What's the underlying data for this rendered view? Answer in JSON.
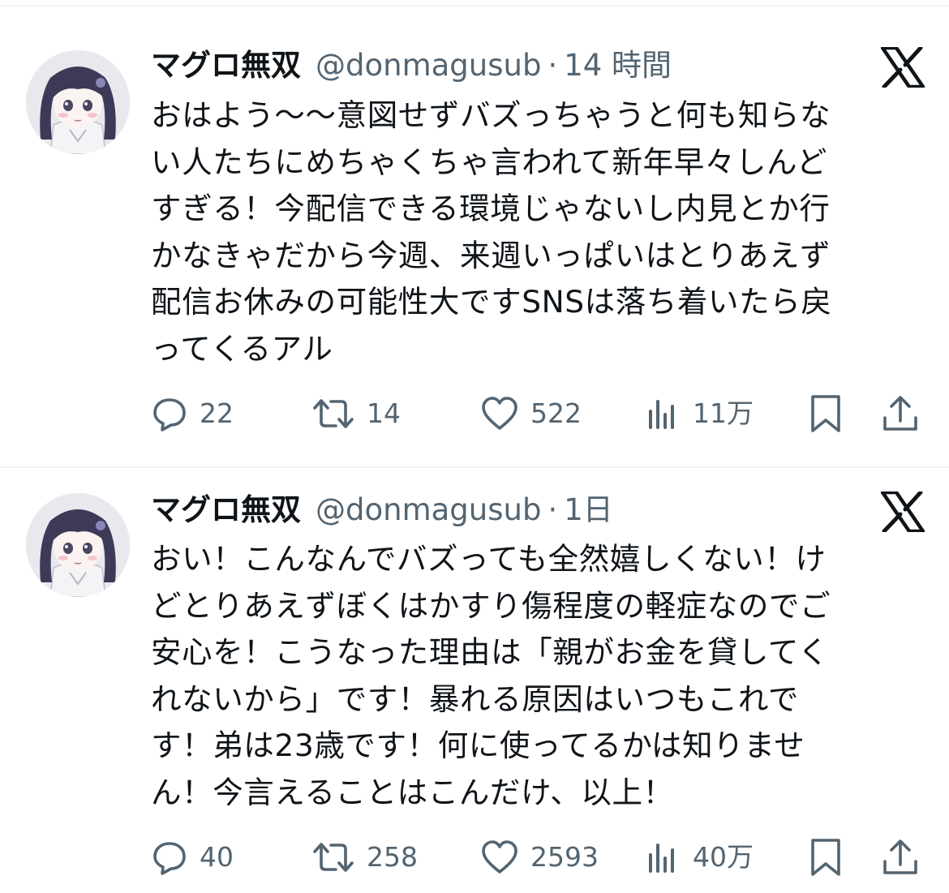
{
  "tweets": [
    {
      "name": "マグロ無双",
      "handle": "@donmagusub",
      "separator": "·",
      "time": "14 時間",
      "text": "おはよう〜〜意図せずバズっちゃうと何も知らな\nい人たちにめちゃくちゃ言われて新年早々しんど\nすぎる！今配信できる環境じゃないし内見とか行\nかなきゃだから今週、来週いっぱいはとりあえず\n配信お休みの可能性大ですSNSは落ち着いたら戻\nってくるアル",
      "replies": "22",
      "retweets": "14",
      "likes": "522",
      "views": "11万"
    },
    {
      "name": "マグロ無双",
      "handle": "@donmagusub",
      "separator": "·",
      "time": "1日",
      "text": "おい！こんなんでバズっても全然嬉しくない！け\nどとりあえずぼくはかすり傷程度の軽症なのでご\n安心を！こうなった理由は「親がお金を貸してく\nれないから」です！暴れる原因はいつもこれで\nす！弟は23歳です！何に使ってるかは知りませ\nん！今言えることはこんだけ、以上！",
      "replies": "40",
      "retweets": "258",
      "likes": "2593",
      "views": "40万"
    }
  ],
  "icons": {
    "logo": "x-logo-icon",
    "reply": "reply-bubble-icon",
    "retweet": "retweet-icon",
    "like": "heart-icon",
    "views": "views-bar-chart-icon",
    "bookmark": "bookmark-icon",
    "share": "share-icon"
  },
  "colors": {
    "text": "#0f1419",
    "secondary": "#536471",
    "divider": "#eff3f4",
    "background": "#ffffff"
  }
}
